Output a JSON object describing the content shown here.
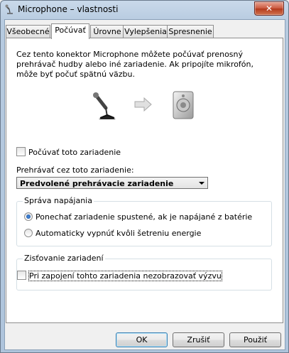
{
  "window": {
    "title": "Microphone – vlastnosti",
    "close_label": "✕"
  },
  "tabs": [
    {
      "label": "Všeobecné",
      "active": false
    },
    {
      "label": "Počúvať",
      "active": true
    },
    {
      "label": "Úrovne",
      "active": false
    },
    {
      "label": "Vylepšenia",
      "active": false
    },
    {
      "label": "Spresnenie",
      "active": false
    }
  ],
  "listen": {
    "description": "Cez tento konektor Microphone môžete počúvať prenosný prehrávač hudby alebo iné zariadenie. Ak pripojíte mikrofón, môže byť počuť spätnú väzbu.",
    "icons": [
      "microphone-icon",
      "arrow-right-icon",
      "speaker-icon"
    ],
    "listen_checkbox_label": "Počúvať toto zariadenie",
    "listen_checked": false,
    "playback_label": "Prehrávať cez toto zariadenie:",
    "playback_selected": "Predvolené prehrávacie zariadenie"
  },
  "power": {
    "group_title": "Správa napájania",
    "options": [
      {
        "label": "Ponechať zariadenie spustené, ak je napájané z batérie",
        "checked": true
      },
      {
        "label": "Automaticky vypnúť kvôli šetreniu energie",
        "checked": false
      }
    ]
  },
  "detection": {
    "group_title": "Zisťovanie zariadení",
    "checkbox_label": "Pri zapojení tohto zariadenia nezobrazovať výzvu",
    "checked": false
  },
  "buttons": {
    "ok": "OK",
    "cancel": "Zrušiť",
    "apply": "Použiť"
  }
}
